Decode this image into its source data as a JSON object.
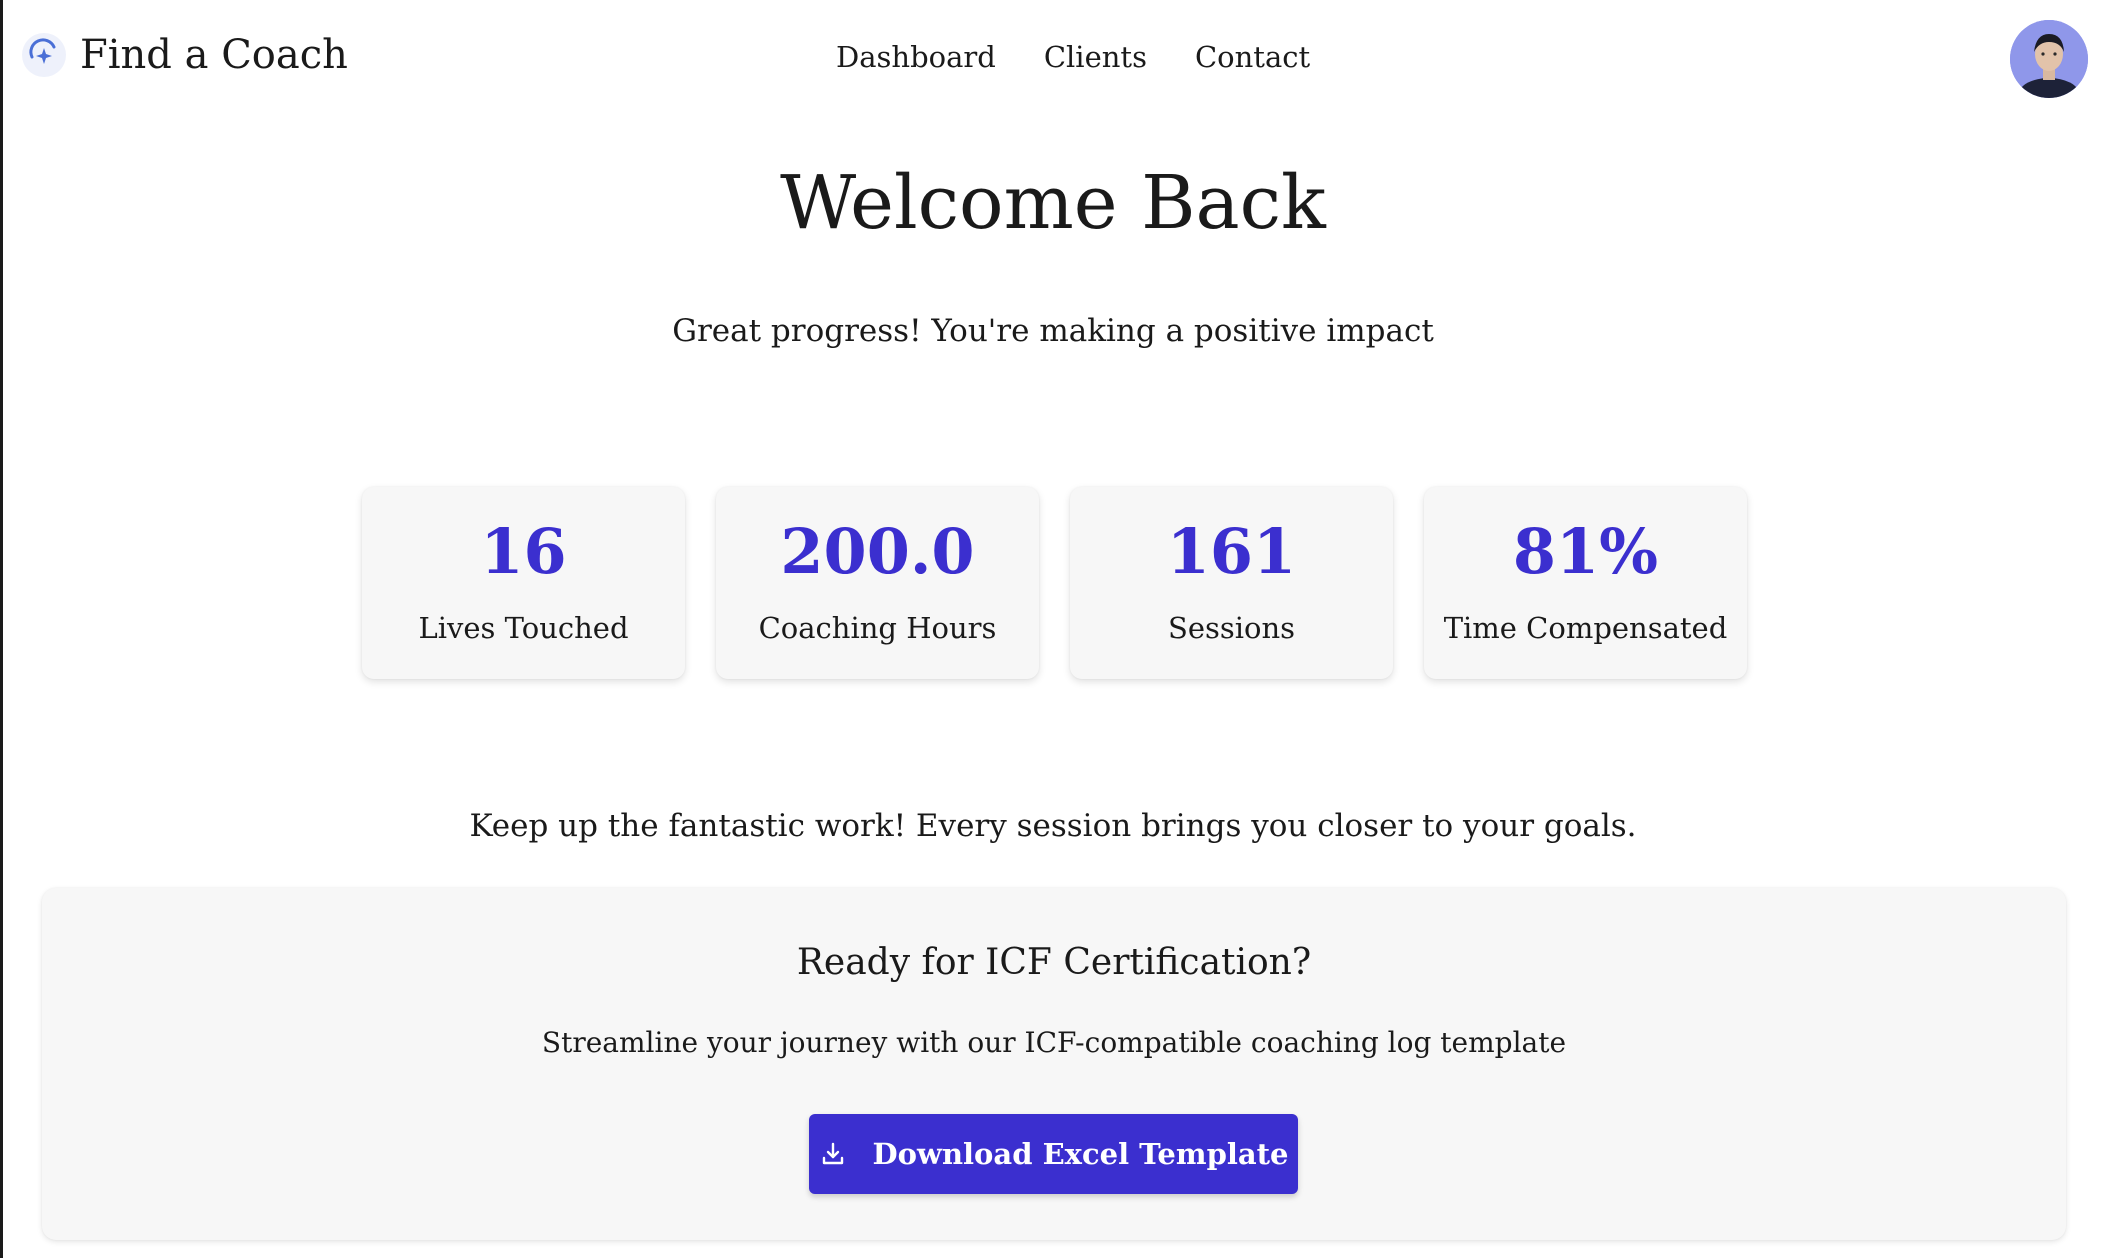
{
  "header": {
    "brand_name": "Find a Coach",
    "logo_icon": "compass-logo-icon",
    "nav": [
      {
        "label": "Dashboard"
      },
      {
        "label": "Clients"
      },
      {
        "label": "Contact"
      }
    ],
    "avatar_icon": "user-avatar"
  },
  "hero": {
    "title": "Welcome Back",
    "subtitle": "Great progress! You're making a positive impact"
  },
  "stats": [
    {
      "value": "16",
      "label": "Lives Touched"
    },
    {
      "value": "200.0",
      "label": "Coaching Hours"
    },
    {
      "value": "161",
      "label": "Sessions"
    },
    {
      "value": "81%",
      "label": "Time Compensated"
    }
  ],
  "encouragement": "Keep up the fantastic work! Every session brings you closer to your goals.",
  "icf": {
    "title": "Ready for ICF Certification?",
    "description": "Streamline your journey with our ICF-compatible coaching log template",
    "button_label": "Download Excel Template",
    "button_icon": "download-icon"
  },
  "colors": {
    "accent": "#3b2fcf",
    "card_bg": "#f7f7f7",
    "text": "#1a1a1a"
  }
}
